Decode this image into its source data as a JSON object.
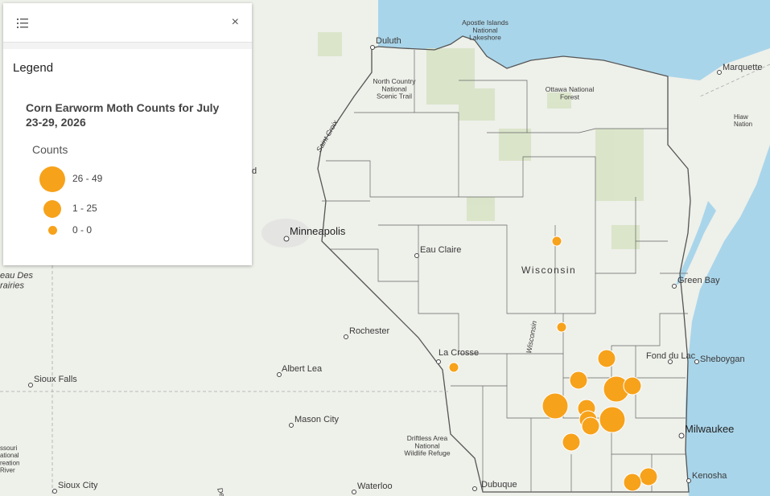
{
  "map": {
    "cities": [
      {
        "name": "Duluth"
      },
      {
        "name": "Marquette"
      },
      {
        "name": "Minneapolis"
      },
      {
        "name": "Eau Claire"
      },
      {
        "name": "Green Bay"
      },
      {
        "name": "Rochester"
      },
      {
        "name": "La Crosse"
      },
      {
        "name": "Fond du Lac"
      },
      {
        "name": "Sheboygan"
      },
      {
        "name": "Albert Lea"
      },
      {
        "name": "Sioux Falls"
      },
      {
        "name": "Mason City"
      },
      {
        "name": "Milwaukee"
      },
      {
        "name": "Kenosha"
      },
      {
        "name": "Sioux City"
      },
      {
        "name": "Waterloo"
      },
      {
        "name": "Dubuque"
      }
    ],
    "state_label": "Wisconsin",
    "park_labels": {
      "apostle": "Apostle Islands National Lakeshore",
      "north_country": "North Country National Scenic Trail",
      "ottawa": "Ottawa National Forest",
      "driftless": "Driftless Area National Wildlife Refuge"
    },
    "river_labels": {
      "st_croix": "Saint Croix",
      "wisconsin_river": "Wisconsin",
      "des_moines": "Des M"
    },
    "edge_labels": {
      "coteau": "eau Des\nrairies",
      "hiaw": "Hiaw\nNation",
      "missouri": "ssouri\national\nreation\nRiver",
      "d": "d"
    },
    "colors": {
      "water": "#a9d5ea",
      "land": "#eef0ea",
      "forest": "#d8e3c6",
      "symbol": "#f7a21b",
      "boundary": "#555555"
    }
  },
  "legend": {
    "title": "Legend",
    "layer_title": "Corn Earworm Moth Counts for July 23-29, 2026",
    "field": "Counts",
    "classes": [
      {
        "label": "26 - 49"
      },
      {
        "label": "1 - 25"
      },
      {
        "label": "0 - 0"
      }
    ],
    "list_icon": "list-icon",
    "close_icon": "close-icon",
    "close_glyph": "×"
  }
}
